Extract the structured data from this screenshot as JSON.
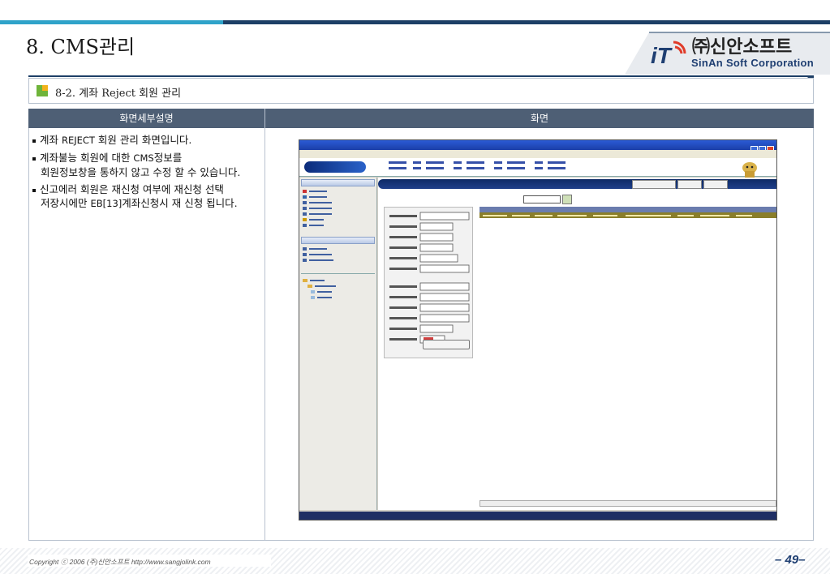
{
  "page": {
    "title": "8. CMS관리",
    "section_title": "8-2. 계좌 Reject 회원 관리"
  },
  "logo": {
    "name": "㈜신안소프트",
    "sub": "SinAn Soft Corporation"
  },
  "table": {
    "headers": [
      "화면세부설명",
      "화면"
    ],
    "desc_1_pre": "계좌 ",
    "desc_1_code": "REJECT",
    "desc_1_post": " 회원 관리 화면입니다.",
    "desc_2a_pre": "계좌불능 회원에 대한 ",
    "desc_2a_code": "CMS",
    "desc_2a_post": "정보를",
    "desc_2b": "회원정보창을 통하지 않고 수정 할 수 있습니다.",
    "desc_3a": "신고에러 회원은 재신청 여부에 재신청 선택",
    "desc_3b_pre": "저장시에만 ",
    "desc_3b_code": "EB[13]",
    "desc_3b_post": "계좌신청시 재 신청 됩니다."
  },
  "footer": {
    "copyright": "Copyright ⓒ 2006 (주)신안소프트  http://www.sangjolink.com",
    "page_number": "– 49–"
  },
  "colors": {
    "accent_light": "#2fa3c9",
    "accent_dark": "#1d3f66",
    "header_bg": "#4e5f75"
  }
}
